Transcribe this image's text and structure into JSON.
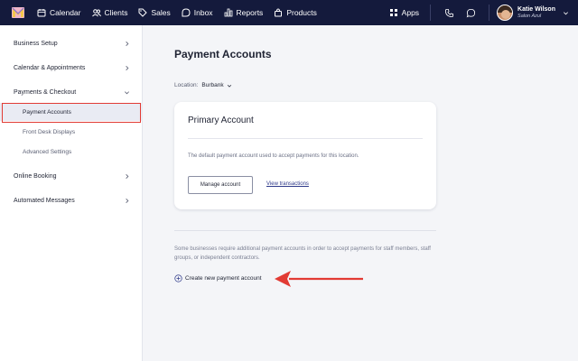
{
  "topnav": {
    "items": [
      {
        "label": "Calendar",
        "icon": "calendar-icon"
      },
      {
        "label": "Clients",
        "icon": "users-icon"
      },
      {
        "label": "Sales",
        "icon": "tag-icon"
      },
      {
        "label": "Inbox",
        "icon": "inbox-icon"
      },
      {
        "label": "Reports",
        "icon": "bar-chart-icon"
      },
      {
        "label": "Products",
        "icon": "bag-icon"
      }
    ],
    "apps_label": "Apps",
    "user": {
      "name": "Katie Wilson",
      "business": "Salon Azul"
    }
  },
  "sidebar": {
    "items": [
      {
        "label": "Business Setup"
      },
      {
        "label": "Calendar & Appointments"
      },
      {
        "label": "Payments & Checkout"
      },
      {
        "label": "Online Booking"
      },
      {
        "label": "Automated Messages"
      }
    ],
    "subitems": [
      {
        "label": "Payment Accounts"
      },
      {
        "label": "Front Desk Displays"
      },
      {
        "label": "Advanced Settings"
      }
    ]
  },
  "main": {
    "title": "Payment Accounts",
    "location_label": "Location:",
    "location_value": "Burbank",
    "card": {
      "title": "Primary Account",
      "description": "The default payment account used to accept payments for this location.",
      "manage_label": "Manage account",
      "view_label": "View transactions"
    },
    "note": "Some businesses require additional payment accounts in order to accept payments for staff members, staff groups, or independent contractors.",
    "create_label": "Create new payment account"
  },
  "colors": {
    "nav_bg": "#141a3c",
    "highlight": "#e23b34",
    "link": "#2f3a8a"
  }
}
